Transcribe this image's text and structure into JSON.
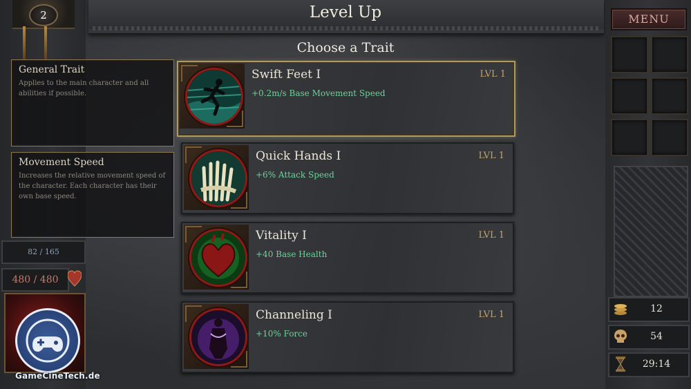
{
  "header": {
    "title": "Level Up",
    "subtitle": "Choose a Trait"
  },
  "player": {
    "level": "2",
    "xp": "82 / 165",
    "hp": "480 / 480"
  },
  "info_panels": [
    {
      "title": "General Trait",
      "description": "Applies to the main character and all abilities if possible."
    },
    {
      "title": "Movement Speed",
      "description": "Increases the relative movement speed of the character. Each character has their own base speed."
    }
  ],
  "traits": [
    {
      "name": "Swift Feet I",
      "level": "LVL 1",
      "effect": "+0.2m/s Base Movement Speed",
      "icon": "running-figure-icon",
      "selected": true
    },
    {
      "name": "Quick Hands I",
      "level": "LVL 1",
      "effect": "+6% Attack Speed",
      "icon": "grasping-hands-icon",
      "selected": false
    },
    {
      "name": "Vitality I",
      "level": "LVL 1",
      "effect": "+40 Base Health",
      "icon": "heart-icon",
      "selected": false
    },
    {
      "name": "Channeling I",
      "level": "LVL 1",
      "effect": "+10% Force",
      "icon": "channeling-figure-icon",
      "selected": false
    }
  ],
  "menu": {
    "label": "MENU"
  },
  "resources": {
    "coins": "12",
    "kills": "54",
    "time": "29:14"
  },
  "watermark": "GameCineTech.de",
  "colors": {
    "effect_green": "#6dd39a",
    "level_gold": "#c9a46a",
    "selected_border": "#b09a62"
  }
}
